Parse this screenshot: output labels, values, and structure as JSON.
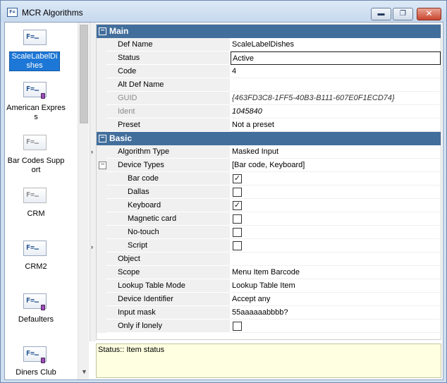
{
  "window": {
    "title": "MCR Algorithms",
    "icon": "algorithm-app-icon",
    "buttons": {
      "minimize": "▬",
      "maximize": "❐",
      "close": "✕"
    }
  },
  "algorithm_list": {
    "items": [
      {
        "icon_text": "F=…",
        "icon": "algorithm-icon",
        "label": "ScaleLabelDishes",
        "selected": true,
        "enabled": true,
        "has_mark": false
      },
      {
        "icon_text": "F=…",
        "icon": "algorithm-icon",
        "label": "American Express",
        "selected": false,
        "enabled": true,
        "has_mark": true
      },
      {
        "icon_text": "F=…",
        "icon": "algorithm-icon",
        "label": "Bar Codes Support",
        "selected": false,
        "enabled": false,
        "has_mark": false
      },
      {
        "icon_text": "F=…",
        "icon": "algorithm-icon",
        "label": "CRM",
        "selected": false,
        "enabled": false,
        "has_mark": false
      },
      {
        "icon_text": "F=…",
        "icon": "algorithm-icon",
        "label": "CRM2",
        "selected": false,
        "enabled": true,
        "has_mark": false
      },
      {
        "icon_text": "F=…",
        "icon": "algorithm-icon",
        "label": "Defaulters",
        "selected": false,
        "enabled": true,
        "has_mark": true
      },
      {
        "icon_text": "F=…",
        "icon": "algorithm-icon",
        "label": "Diners Club",
        "selected": false,
        "enabled": true,
        "has_mark": true
      }
    ]
  },
  "properties": {
    "main": {
      "header": "Main",
      "rows": [
        {
          "name": "Def Name",
          "value": "ScaleLabelDishes"
        },
        {
          "name": "Status",
          "value": "Active"
        },
        {
          "name": "Code",
          "value": "4"
        },
        {
          "name": "Alt Def Name",
          "value": ""
        },
        {
          "name": "GUID",
          "value": "{463FD3C8-1FF5-40B3-B111-607E0F1ECD74}"
        },
        {
          "name": "Ident",
          "value": "1045840"
        },
        {
          "name": "Preset",
          "value": "Not a preset"
        }
      ]
    },
    "basic": {
      "header": "Basic",
      "rows": [
        {
          "name": "Algorithm Type",
          "value": "Masked Input"
        },
        {
          "name": "Device Types",
          "value": "[Bar code, Keyboard]"
        },
        {
          "name": "Bar code",
          "checked": true
        },
        {
          "name": "Dallas",
          "checked": false
        },
        {
          "name": "Keyboard",
          "checked": true
        },
        {
          "name": "Magnetic card",
          "checked": false
        },
        {
          "name": "No-touch",
          "checked": false
        },
        {
          "name": "Script",
          "checked": false
        },
        {
          "name": "Object",
          "value": ""
        },
        {
          "name": "Scope",
          "value": "Menu Item Barcode"
        },
        {
          "name": "Lookup Table Mode",
          "value": "Lookup Table Item"
        },
        {
          "name": "Device Identifier",
          "value": "Accept any"
        },
        {
          "name": "Input mask",
          "value": "55aaaaaabbbb?"
        },
        {
          "name": "Only if lonely",
          "checked": false
        }
      ]
    }
  },
  "status_panel": {
    "text": "Status:: Item status"
  },
  "glyphs": {
    "collapse": "−",
    "check": "✓",
    "splitter_arrow": "›",
    "scroll_down": "▼"
  }
}
